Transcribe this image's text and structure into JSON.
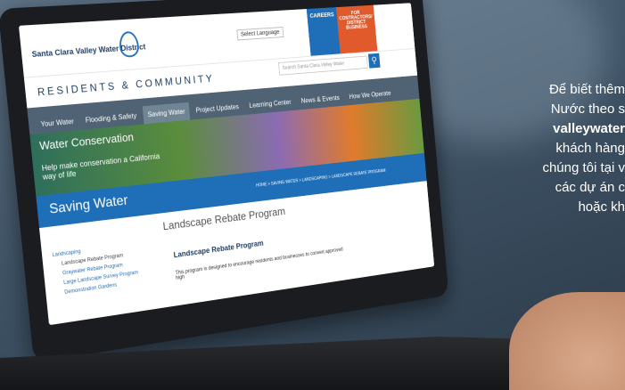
{
  "site": {
    "logo_text": "Santa Clara Valley Water District",
    "language_label": "Select Language",
    "careers_label": "CAREERS",
    "contractors_label": "FOR CONTRACTORS/ DISTRICT BUSINESS",
    "section_title": "RESIDENTS & COMMUNITY",
    "search_placeholder": "Search Santa Clara Valley Water"
  },
  "nav": {
    "items": [
      {
        "label": "Your Water"
      },
      {
        "label": "Flooding & Safety"
      },
      {
        "label": "Saving Water"
      },
      {
        "label": "Project Updates"
      },
      {
        "label": "Learning Center"
      },
      {
        "label": "News & Events"
      },
      {
        "label": "How We Operate"
      }
    ]
  },
  "hero": {
    "title": "Water Conservation",
    "subtitle": "Help make conservation a California way of life"
  },
  "band": {
    "title": "Saving Water",
    "breadcrumb": "HOME > SAVING WATER > LANDSCAPING > LANDSCAPE REBATE PROGRAM"
  },
  "sidebar": {
    "heading": "Landscaping",
    "items": [
      {
        "label": "Landscape Rebate Program"
      },
      {
        "label": "Graywater Rebate Program"
      },
      {
        "label": "Large Landscape Survey Program"
      },
      {
        "label": "Demonstration Gardens"
      }
    ]
  },
  "main": {
    "title": "Landscape Rebate Program",
    "heading": "Landscape Rebate Program",
    "paragraph": "This program is designed to encourage residents and businesses to convert approved high"
  },
  "overlay": {
    "lines": [
      "Để biết thêm",
      "Nước theo s",
      "valleywater",
      "khách hàng",
      "chúng tôi tại v",
      "các dự án c",
      "hoặc kh"
    ]
  }
}
